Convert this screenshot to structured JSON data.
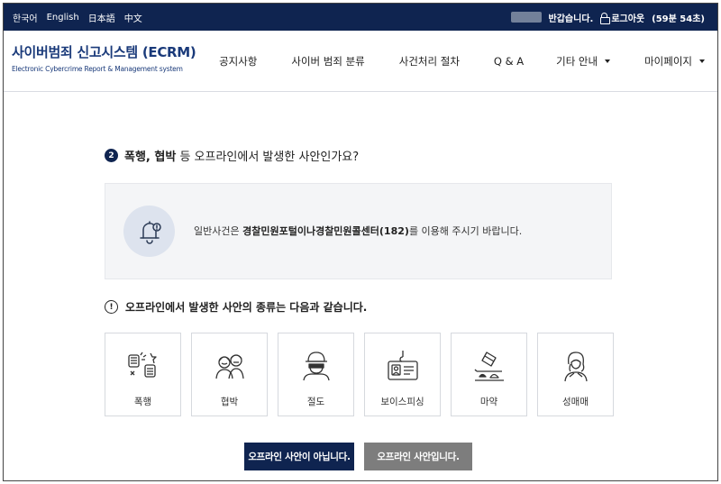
{
  "topbar": {
    "languages": [
      "한국어",
      "English",
      "日本語",
      "中文"
    ],
    "greeting": "반갑습니다.",
    "logout_label": "로그아웃",
    "session_timer": "(59분 54초)"
  },
  "header": {
    "title": "사이버범죄 신고시스템 (ECRM)",
    "subtitle": "Electronic Cybercrime Report & Management system",
    "nav": [
      {
        "label": "공지사항",
        "dropdown": false
      },
      {
        "label": "사이버 범죄 분류",
        "dropdown": false
      },
      {
        "label": "사건처리 절차",
        "dropdown": false
      },
      {
        "label": "Q & A",
        "dropdown": false
      },
      {
        "label": "기타 안내",
        "dropdown": true
      },
      {
        "label": "마이페이지",
        "dropdown": true
      }
    ]
  },
  "question": {
    "number": "2",
    "bold": "폭행, 협박",
    "rest": " 등 오프라인에서 발생한 사안인가요?"
  },
  "notice": {
    "icon": "bell-alert-icon",
    "prefix": "일반사건은 ",
    "bold": "경찰민원포털이나경찰민원콜센터(182)",
    "suffix": "를 이용해 주시기 바랍니다."
  },
  "info": {
    "icon_text": "!",
    "title": "오프라인에서 발생한 사안의 종류는 다음과 같습니다."
  },
  "categories": [
    {
      "label": "폭행",
      "icon": "assault-icon"
    },
    {
      "label": "협박",
      "icon": "threat-icon"
    },
    {
      "label": "절도",
      "icon": "theft-icon"
    },
    {
      "label": "보이스피싱",
      "icon": "voice-phishing-icon"
    },
    {
      "label": "마약",
      "icon": "drug-icon"
    },
    {
      "label": "성매매",
      "icon": "prostitution-icon"
    }
  ],
  "buttons": {
    "not_offline": "오프라인 사안이 아닙니다.",
    "is_offline": "오프라인 사안입니다."
  },
  "colors": {
    "navy": "#0f2450",
    "gray_button": "#7d7d7d",
    "notice_bg": "#f4f5f7"
  }
}
